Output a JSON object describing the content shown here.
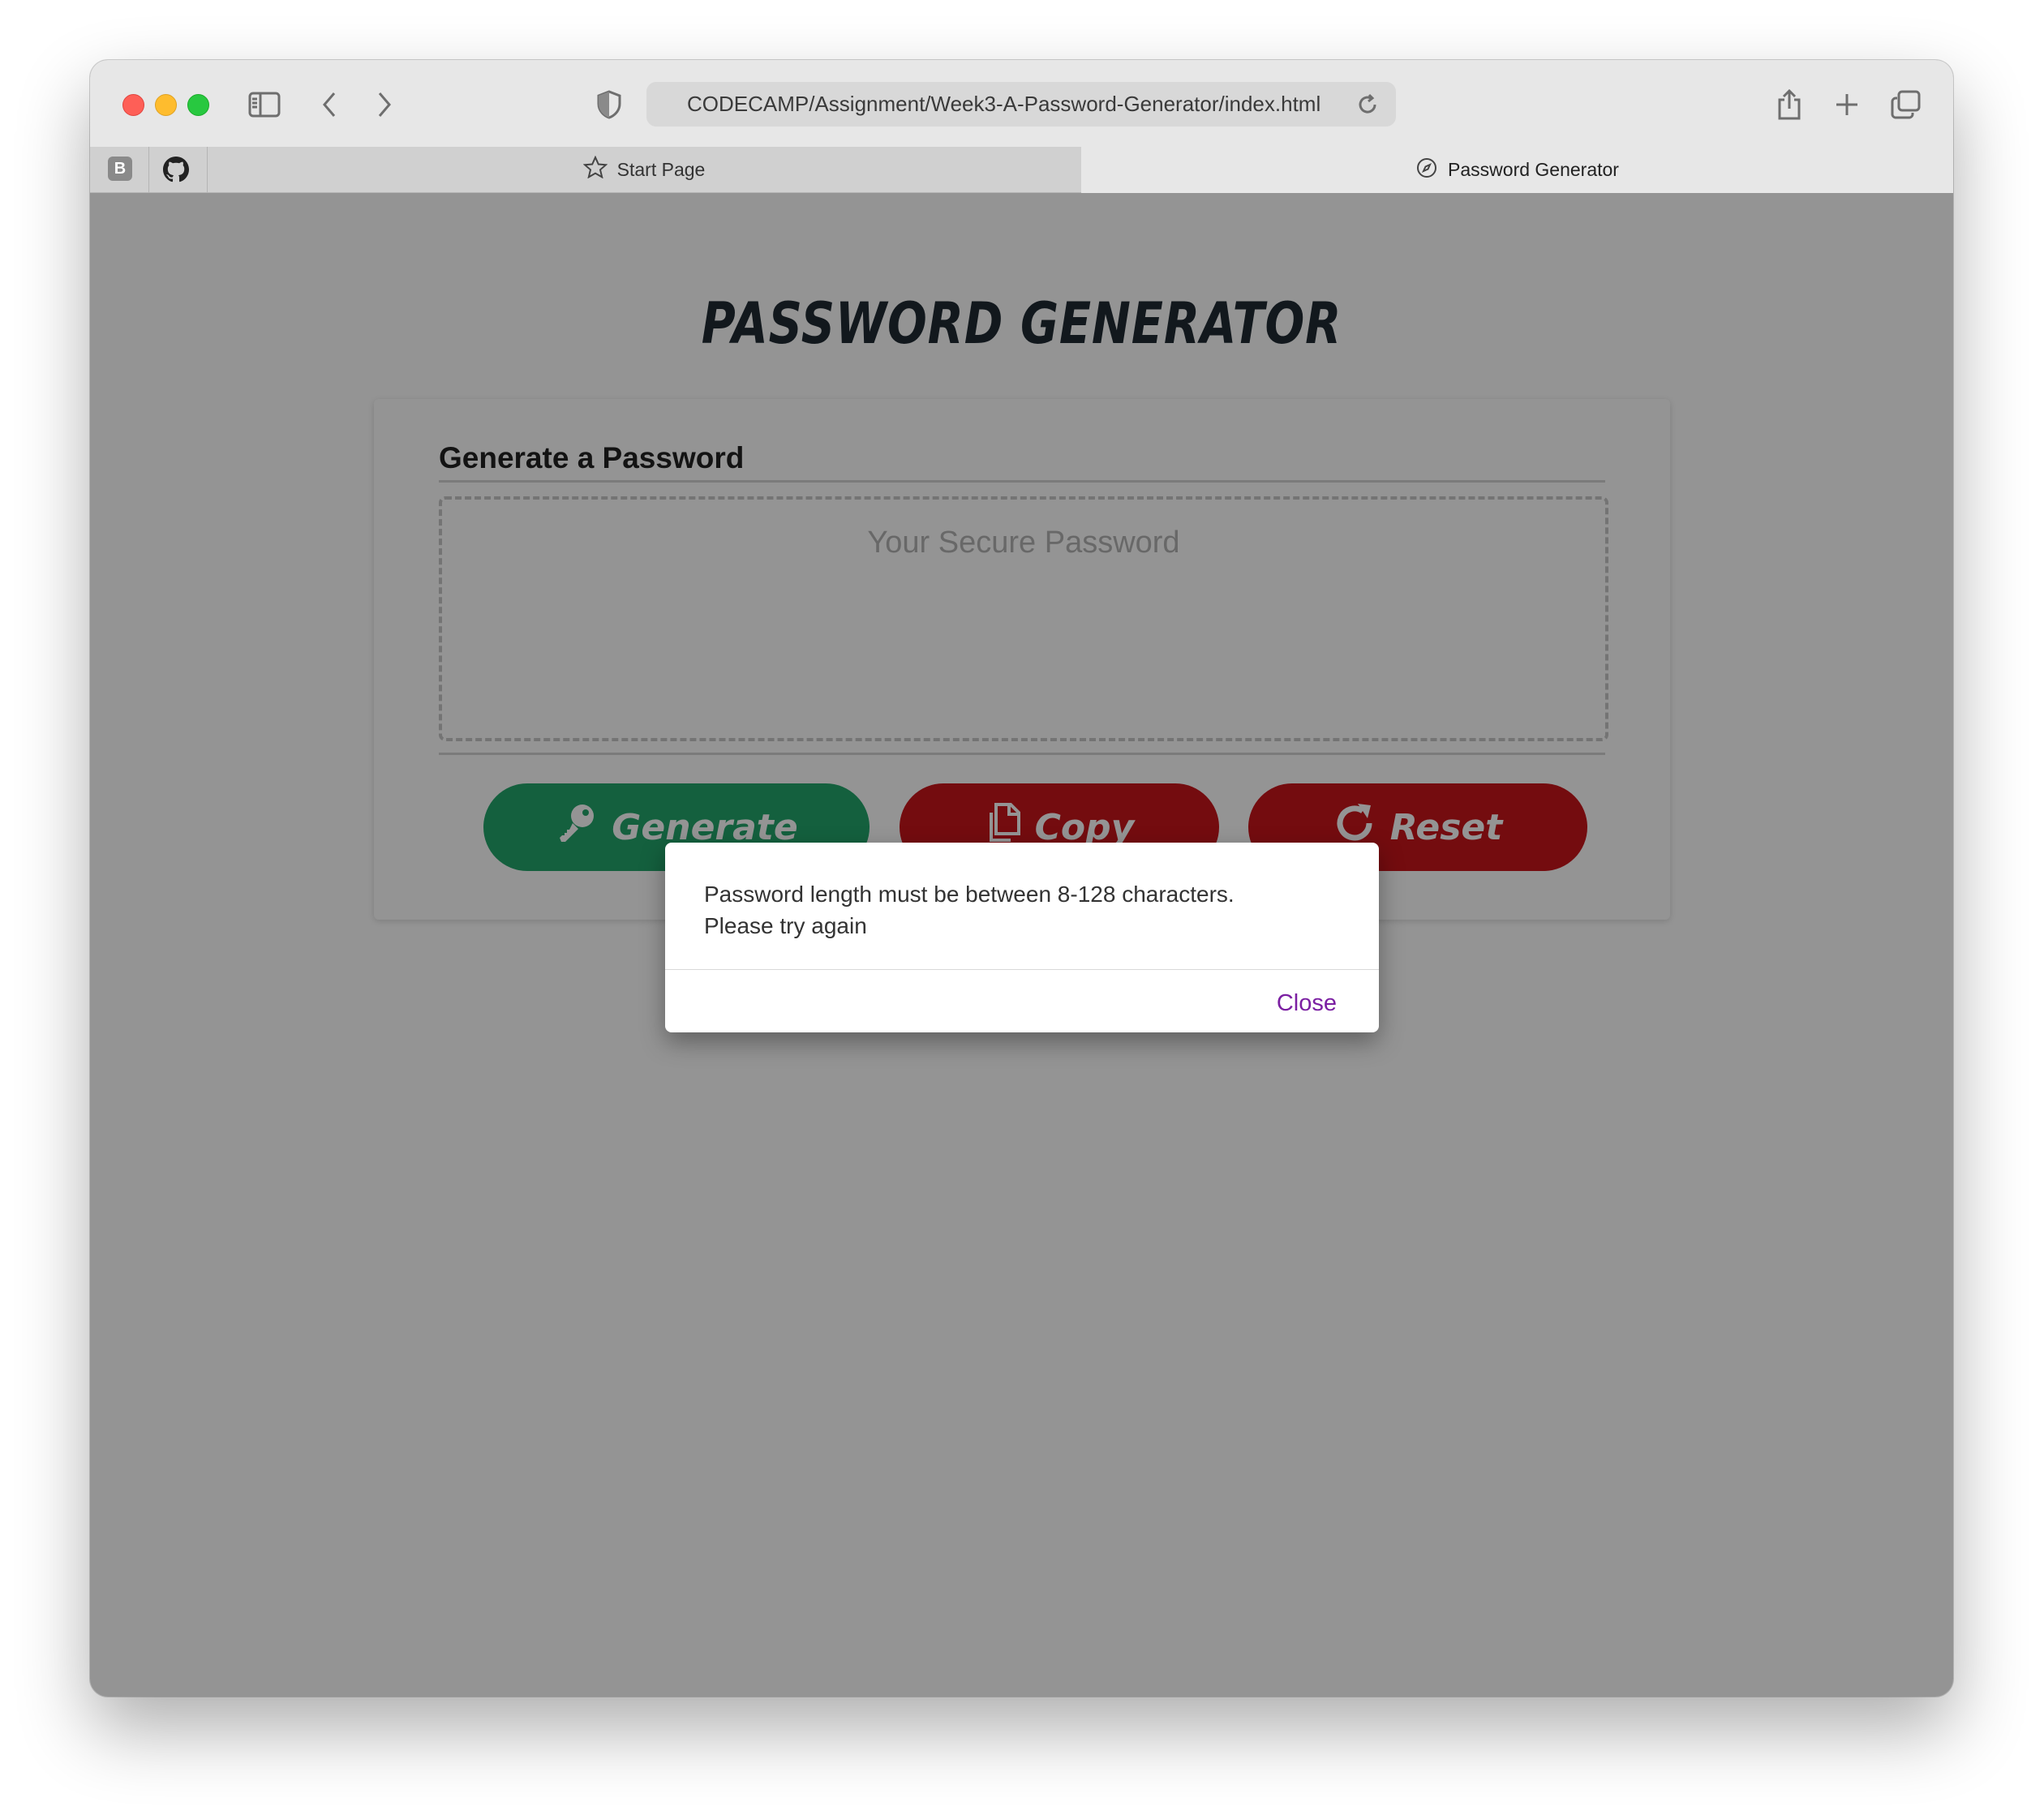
{
  "browser": {
    "url": "CODECAMP/Assignment/Week3-A-Password-Generator/index.html",
    "favorites": [
      {
        "name": "bookmark-b",
        "label": "B"
      },
      {
        "name": "github",
        "label": ""
      }
    ],
    "tabs": [
      {
        "label": "Start Page",
        "active": false
      },
      {
        "label": "Password Generator",
        "active": true
      }
    ]
  },
  "page": {
    "title": "PASSWORD GENERATOR",
    "card": {
      "title": "Generate a Password",
      "password_placeholder": "Your Secure Password"
    },
    "buttons": {
      "generate": "Generate",
      "copy": "Copy",
      "reset": "Reset"
    }
  },
  "dialog": {
    "message_line1": "Password length must be between 8-128 characters.",
    "message_line2": "Please try again",
    "close_label": "Close"
  },
  "colors": {
    "generate_button": "#23a66b",
    "copy_button": "#c8161b",
    "reset_button": "#c8161b",
    "dialog_action": "#7b1fa2"
  }
}
